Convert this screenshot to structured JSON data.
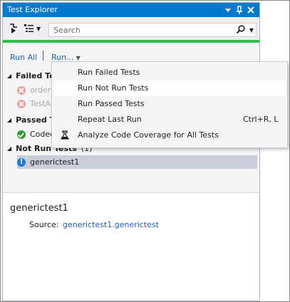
{
  "window": {
    "title": "Test Explorer",
    "title_icons": [
      "pin-dropdown-icon",
      "pin-icon",
      "close-icon"
    ]
  },
  "toolbar": {
    "search_placeholder": "Search",
    "icons": [
      "run-tests-icon",
      "group-by-icon",
      "search-icon"
    ]
  },
  "run_bar": {
    "run_all": "Run All",
    "separator": "|",
    "run_dropdown": "Run..."
  },
  "tree": {
    "groups": [
      {
        "label": "Failed Te",
        "count": "",
        "items": [
          "ordere",
          "TestA"
        ]
      },
      {
        "label": "Passed T",
        "count": "",
        "items": [
          "Codec"
        ]
      },
      {
        "label": "Not Run Tests",
        "count": "(1)",
        "items": [
          "generictest1"
        ]
      }
    ]
  },
  "details": {
    "title": "generictest1",
    "source_label": "Source:",
    "source_value": "generictest1.generictest"
  },
  "run_menu": {
    "items": [
      {
        "label": "Run Failed Tests",
        "shortcut": ""
      },
      {
        "label": "Run Not Run Tests",
        "shortcut": ""
      },
      {
        "label": "Run Passed Tests",
        "shortcut": ""
      },
      {
        "label": "Repeat Last Run",
        "shortcut": "Ctrl+R, L"
      },
      {
        "label": "Analyze Code Coverage for All Tests",
        "shortcut": "",
        "icon": "code-coverage-icon"
      }
    ],
    "hovered_index": 1
  },
  "colors": {
    "title_bar": "#007acc",
    "pass_bar": "#2bc04b",
    "link": "#1b62ba",
    "selection": "#cacdda"
  }
}
